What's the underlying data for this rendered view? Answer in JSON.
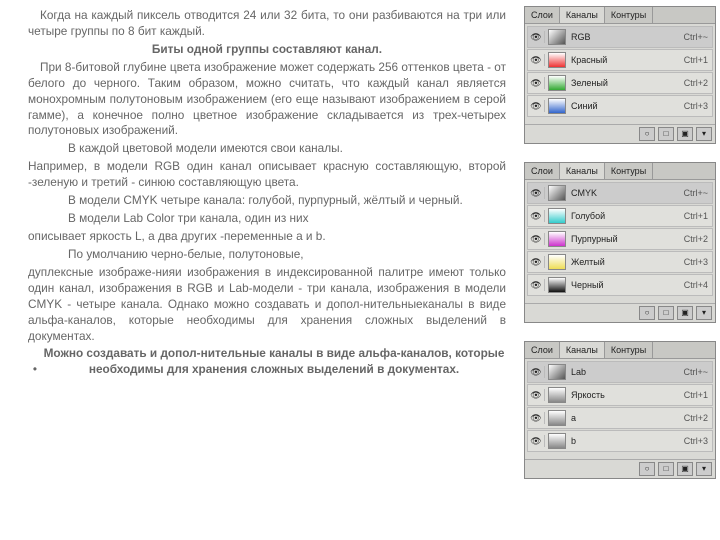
{
  "text": {
    "p1": "Когда на каждый пиксель отводится 24 или 32 бита, то они разбиваются на три или четыре группы по 8 бит каждый.",
    "p2": "Биты одной группы составляют канал.",
    "p3a": "При 8-битовой глубине цвета изображение может содержать 256 оттенков цвета - от белого до черного. Таким образом, можно считать, что каждый канал является монохромным полутоновым изображением (его еще называют изображением в серой гамме), а конечное полно цветное изображение складывается из трех-четырех полутоновых изображений.",
    "p4": "В каждой цветовой модели имеются свои каналы.",
    "p5": "Например, в модели RGB один канал описывает красную составляющую, второй -зеленую и третий - синюю составляющую цвета.",
    "p6": "В модели CMYK четыре канала: голубой, пурпурный, жёлтый и черный.",
    "p7": "В модели Lab Color три канала, один из них",
    "p8": "описывает яркость L, а два других -переменные a и b.",
    "p9": "По умолчанию черно-белые, полутоновые,",
    "p10": "дуплексные изображе-нияи изображения в индексированной палитре имеют только один канал, изображения в RGB и Lab-модели - три канала, изображения в модели CMYK - четыре канала. Однако можно создавать и допол-нительныеканалы в виде альфа-каналов, которые необходимы для хранения сложных выделений в документах.",
    "p11": "Можно создавать и допол-нительные каналы в виде альфа-каналов, которые необходимы для хранения сложных выделений в документах.",
    "bullet": "•"
  },
  "eye": "👁",
  "panels": [
    {
      "tabs": [
        "Слои",
        "Каналы",
        "Контуры"
      ],
      "rows": [
        {
          "thumb": "th-grad",
          "name": "RGB",
          "sc": "Ctrl+~",
          "full": true
        },
        {
          "thumb": "th-red",
          "name": "Красный",
          "sc": "Ctrl+1"
        },
        {
          "thumb": "th-green",
          "name": "Зеленый",
          "sc": "Ctrl+2"
        },
        {
          "thumb": "th-blue",
          "name": "Синий",
          "sc": "Ctrl+3"
        }
      ]
    },
    {
      "tabs": [
        "Слои",
        "Каналы",
        "Контуры"
      ],
      "rows": [
        {
          "thumb": "th-grad",
          "name": "CMYK",
          "sc": "Ctrl+~",
          "full": true
        },
        {
          "thumb": "th-cyan",
          "name": "Голубой",
          "sc": "Ctrl+1"
        },
        {
          "thumb": "th-mag",
          "name": "Пурпурный",
          "sc": "Ctrl+2"
        },
        {
          "thumb": "th-yel",
          "name": "Желтый",
          "sc": "Ctrl+3"
        },
        {
          "thumb": "th-blk",
          "name": "Черный",
          "sc": "Ctrl+4"
        }
      ]
    },
    {
      "tabs": [
        "Слои",
        "Каналы",
        "Контуры"
      ],
      "rows": [
        {
          "thumb": "th-grad",
          "name": "Lab",
          "sc": "Ctrl+~",
          "full": true
        },
        {
          "thumb": "th-gray",
          "name": "Яркость",
          "sc": "Ctrl+1"
        },
        {
          "thumb": "th-gray",
          "name": "a",
          "sc": "Ctrl+2"
        },
        {
          "thumb": "th-gray",
          "name": "b",
          "sc": "Ctrl+3"
        }
      ]
    }
  ],
  "footicons": [
    "○",
    "□",
    "▣",
    "▾"
  ]
}
